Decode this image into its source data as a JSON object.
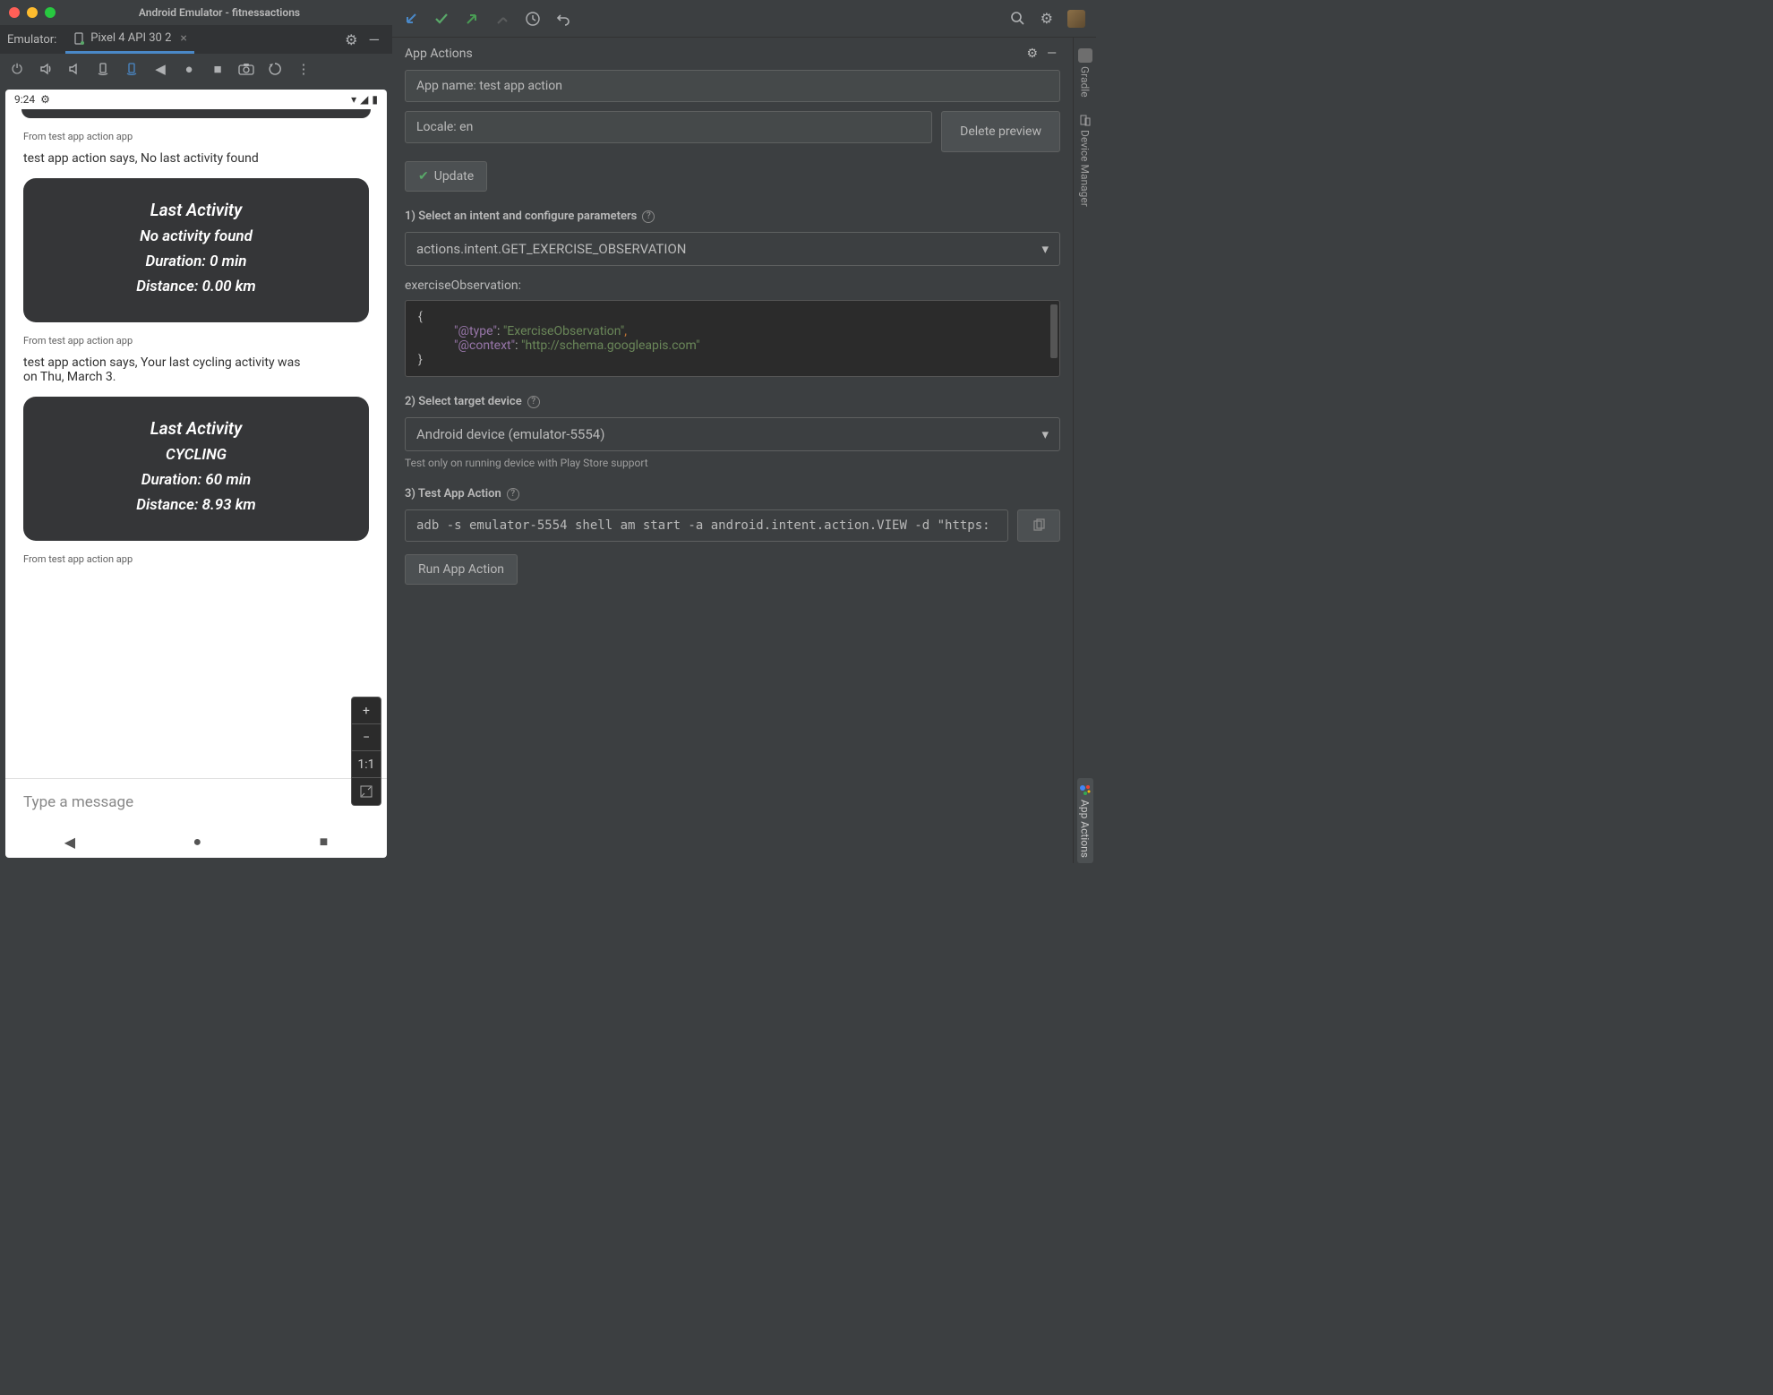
{
  "emulator": {
    "window_title": "Android Emulator - fitnessactions",
    "tab_prefix": "Emulator:",
    "tab_device": "Pixel 4 API 30 2",
    "android": {
      "time": "9:24",
      "messages": [
        {
          "from": "From test app action app",
          "says": "test app action says, No last activity found",
          "card": {
            "title": "Last Activity",
            "l1": "No activity found",
            "l2": "Duration: 0 min",
            "l3": "Distance: 0.00 km"
          }
        },
        {
          "from": "From test app action app",
          "says": "test app action says, Your last cycling activity was on Thu, March 3.",
          "card": {
            "title": "Last Activity",
            "l1": "CYCLING",
            "l2": "Duration: 60 min",
            "l3": "Distance: 8.93 km"
          }
        },
        {
          "from": "From test app action app"
        }
      ],
      "compose_placeholder": "Type a message",
      "zoom": {
        "plus": "+",
        "minus": "−",
        "oneone": "1:1"
      }
    }
  },
  "appactions": {
    "panel_title": "App Actions",
    "app_name_field": "App name: test app action",
    "locale_field": "Locale: en",
    "delete_btn": "Delete preview",
    "update_btn": "Update",
    "step1": "1) Select an intent and configure parameters",
    "intent_selected": "actions.intent.GET_EXERCISE_OBSERVATION",
    "param_label": "exerciseObservation:",
    "json": {
      "open": "{",
      "k1": "\"@type\"",
      "v1": "\"ExerciseObservation\"",
      "k2": "\"@context\"",
      "v2": "\"http://schema.googleapis.com\"",
      "close": "}"
    },
    "step2": "2) Select target device",
    "device_selected": "Android device (emulator-5554)",
    "device_note": "Test only on running device with Play Store support",
    "step3": "3) Test App Action",
    "adb_cmd": "adb -s emulator-5554 shell am start -a android.intent.action.VIEW -d \"https:",
    "run_btn": "Run App Action"
  },
  "sidetabs": {
    "gradle": "Gradle",
    "device_manager": "Device Manager",
    "app_actions": "App Actions"
  }
}
